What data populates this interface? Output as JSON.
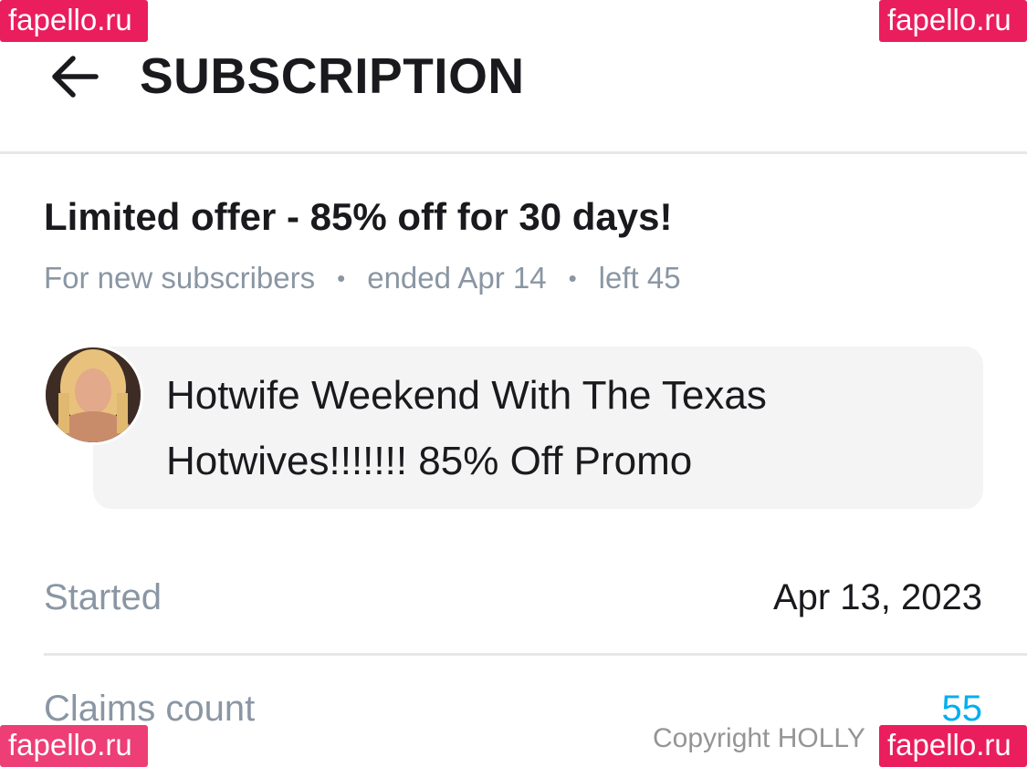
{
  "header": {
    "title": "SUBSCRIPTION",
    "back_icon": "arrow-left-icon"
  },
  "offer": {
    "title": "Limited offer - 85% off for 30 days!",
    "audience": "For new subscribers",
    "ended": "ended Apr 14",
    "left": "left 45",
    "separator": "•"
  },
  "message": {
    "avatar_icon": "avatar",
    "text": "Hotwife Weekend With The Texas Hotwives!!!!!!! 85% Off Promo"
  },
  "details": {
    "started_label": "Started",
    "started_value": "Apr 13, 2023",
    "claims_label": "Claims count",
    "claims_value": "55"
  },
  "watermark": {
    "site": "fapello.ru",
    "copyright": "Copyright HOLLY"
  },
  "colors": {
    "accent": "#00aff0",
    "text": "#1a1a1e",
    "muted": "#8a96a3",
    "watermark_bg": "#ea1d5d",
    "bubble_bg": "#f4f4f4"
  }
}
